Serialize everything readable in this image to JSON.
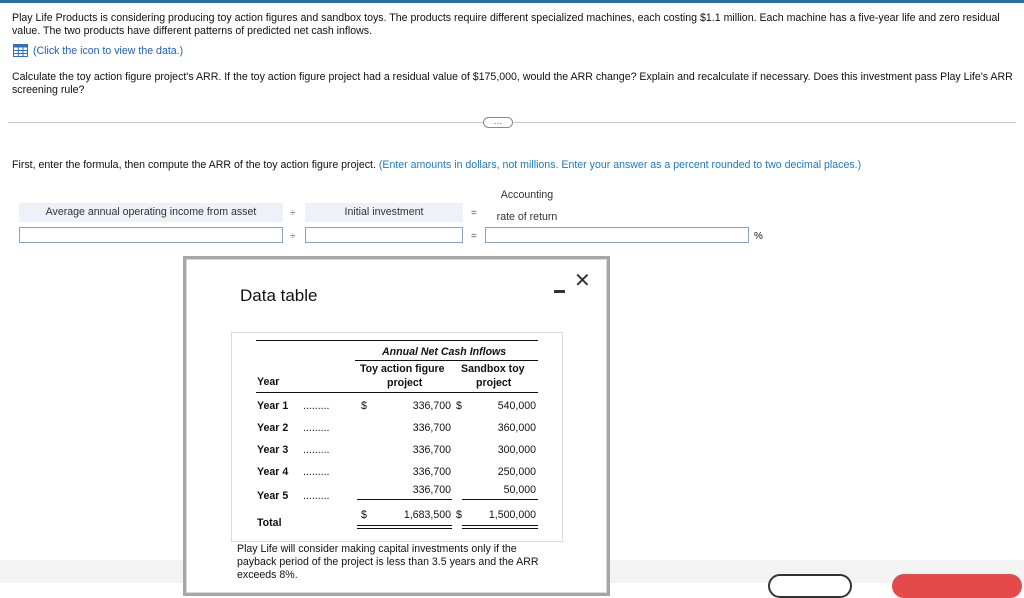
{
  "problem_text": "Play Life Products is considering producing toy action figures and sandbox toys. The products require different specialized machines, each costing $1.1 million. Each machine has a five-year life and zero residual value. The two products have different patterns of predicted net cash inflows.",
  "data_link": "(Click the icon to view the data.)",
  "question_text": "Calculate the toy action figure project's ARR. If the toy action figure project had a residual value of $175,000, would the ARR change? Explain and recalculate if necessary. Does this investment pass Play Life's ARR screening rule?",
  "expand_label": "…",
  "instruction": {
    "main": "First, enter the formula, then compute the ARR of the toy action figure project. ",
    "hint": "(Enter amounts in dollars, not millions. Enter your answer as a percent rounded to two decimal places.)"
  },
  "formula": {
    "label_avg": "Average annual operating income from asset",
    "divide": "÷",
    "label_init": "Initial investment",
    "equals": "=",
    "label_arr_line1": "Accounting",
    "label_arr_line2": "rate of return",
    "input_avg": "",
    "input_init": "",
    "input_arr": "",
    "percent": "%"
  },
  "modal": {
    "title": "Data table",
    "minimize_icon": "minimize-icon",
    "close": "✕",
    "table": {
      "main_header": "Annual Net Cash Inflows",
      "toy_header_1": "Toy action figure",
      "toy_header_2": "project",
      "sand_header_1": "Sandbox toy",
      "sand_header_2": "project",
      "year_header": "Year",
      "dots": ".........",
      "dollar": "$",
      "rows": [
        {
          "year": "Year 1",
          "toy": "336,700",
          "sand": "540,000"
        },
        {
          "year": "Year 2",
          "toy": "336,700",
          "sand": "360,000"
        },
        {
          "year": "Year 3",
          "toy": "336,700",
          "sand": "300,000"
        },
        {
          "year": "Year 4",
          "toy": "336,700",
          "sand": "250,000"
        },
        {
          "year": "Year 5",
          "toy": "336,700",
          "sand": "50,000"
        }
      ],
      "total_label": "Total",
      "total_toy": "1,683,500",
      "total_sand": "1,500,000"
    },
    "footnote": "Play Life will consider making capital investments only if the payback period of the project is less than 3.5 years and the ARR exceeds 8%."
  },
  "colors": {
    "link": "#1f5fb8",
    "hint": "#1f7ab8",
    "topbar": "#2f6f96",
    "accent_button": "#e44a4a"
  }
}
